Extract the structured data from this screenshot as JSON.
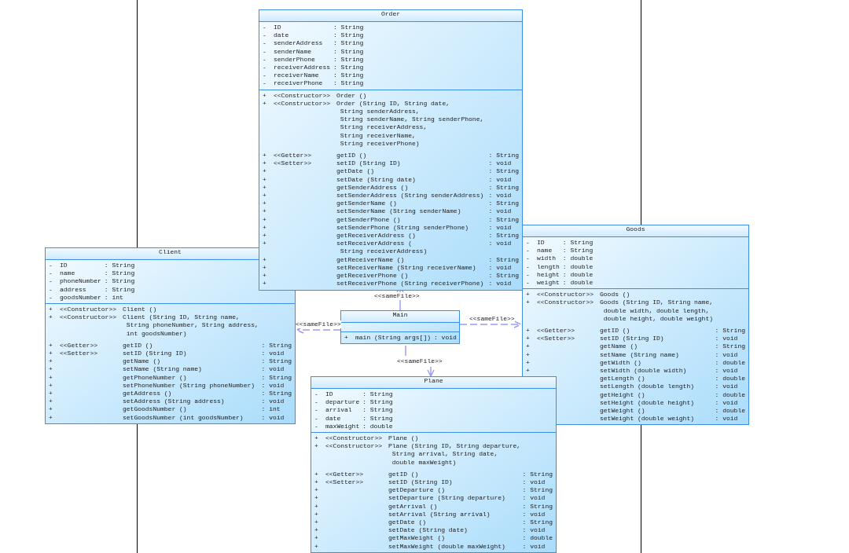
{
  "classes": [
    {
      "name": "Order",
      "attributes": [
        {
          "visibility": "-",
          "name": "ID",
          "type": ": String"
        },
        {
          "visibility": "-",
          "name": "date",
          "type": ": String"
        },
        {
          "visibility": "-",
          "name": "senderAddress",
          "type": ": String"
        },
        {
          "visibility": "-",
          "name": "senderName",
          "type": ": String"
        },
        {
          "visibility": "-",
          "name": "senderPhone",
          "type": ": String"
        },
        {
          "visibility": "-",
          "name": "receiverAddress",
          "type": ": String"
        },
        {
          "visibility": "-",
          "name": "receiverName",
          "type": ": String"
        },
        {
          "visibility": "-",
          "name": "receiverPhone",
          "type": ": String"
        }
      ],
      "operations": [
        {
          "kind": "constructor",
          "visibility": "+",
          "stereotype": "<<Constructor>>",
          "lines": [
            "Order ()"
          ]
        },
        {
          "kind": "constructor",
          "visibility": "+",
          "stereotype": "<<Constructor>>",
          "lines": [
            "Order (String ID, String date,",
            "String senderAddress,",
            "String senderName, String senderPhone,",
            "String receiverAddress,",
            "String receiverName,",
            "String receiverPhone)"
          ]
        },
        {
          "kind": "method",
          "visibility": "+",
          "stereotype": "<<Getter>>",
          "lines": [
            "getID ()"
          ],
          "type": ": String"
        },
        {
          "kind": "method",
          "visibility": "+",
          "stereotype": "<<Setter>>",
          "lines": [
            "setID (String ID)"
          ],
          "type": ": void"
        },
        {
          "kind": "method",
          "visibility": "+",
          "lines": [
            "getDate ()"
          ],
          "type": ": String"
        },
        {
          "kind": "method",
          "visibility": "+",
          "lines": [
            "setDate (String date)"
          ],
          "type": ": void"
        },
        {
          "kind": "method",
          "visibility": "+",
          "lines": [
            "getSenderAddress ()"
          ],
          "type": ": String"
        },
        {
          "kind": "method",
          "visibility": "+",
          "lines": [
            "setSenderAddress (String senderAddress)"
          ],
          "type": ": void"
        },
        {
          "kind": "method",
          "visibility": "+",
          "lines": [
            "getSenderName ()"
          ],
          "type": ": String"
        },
        {
          "kind": "method",
          "visibility": "+",
          "lines": [
            "setSenderName (String senderName)"
          ],
          "type": ": void"
        },
        {
          "kind": "method",
          "visibility": "+",
          "lines": [
            "getSenderPhone ()"
          ],
          "type": ": String"
        },
        {
          "kind": "method",
          "visibility": "+",
          "lines": [
            "setSenderPhone (String senderPhone)"
          ],
          "type": ": void"
        },
        {
          "kind": "method",
          "visibility": "+",
          "lines": [
            "getReceiverAddress ()"
          ],
          "type": ": String"
        },
        {
          "kind": "method",
          "visibility": "+",
          "lines": [
            "setReceiverAddress (",
            "String receiverAddress)"
          ],
          "type": ": void"
        },
        {
          "kind": "method",
          "visibility": "+",
          "lines": [
            "getReceiverName ()"
          ],
          "type": ": String"
        },
        {
          "kind": "method",
          "visibility": "+",
          "lines": [
            "setReceiverName (String receiverName)"
          ],
          "type": ": void"
        },
        {
          "kind": "method",
          "visibility": "+",
          "lines": [
            "getReceiverPhone ()"
          ],
          "type": ": String"
        },
        {
          "kind": "method",
          "visibility": "+",
          "lines": [
            "setReceiverPhone (String receiverPhone)"
          ],
          "type": ": void"
        }
      ]
    },
    {
      "name": "Client",
      "attributes": [
        {
          "visibility": "-",
          "name": "ID",
          "type": ": String"
        },
        {
          "visibility": "-",
          "name": "name",
          "type": ": String"
        },
        {
          "visibility": "-",
          "name": "phoneNumber",
          "type": ": String"
        },
        {
          "visibility": "-",
          "name": "address",
          "type": ": String"
        },
        {
          "visibility": "-",
          "name": "goodsNumber",
          "type": ": int"
        }
      ],
      "operations": [
        {
          "kind": "constructor",
          "visibility": "+",
          "stereotype": "<<Constructor>>",
          "lines": [
            "Client ()"
          ]
        },
        {
          "kind": "constructor",
          "visibility": "+",
          "stereotype": "<<Constructor>>",
          "lines": [
            "Client (String ID, String name,",
            "String phoneNumber, String address,",
            "int goodsNumber)"
          ]
        },
        {
          "kind": "method",
          "visibility": "+",
          "stereotype": "<<Getter>>",
          "lines": [
            "getID ()"
          ],
          "type": ": String"
        },
        {
          "kind": "method",
          "visibility": "+",
          "stereotype": "<<Setter>>",
          "lines": [
            "setID (String ID)"
          ],
          "type": ": void"
        },
        {
          "kind": "method",
          "visibility": "+",
          "lines": [
            "getName ()"
          ],
          "type": ": String"
        },
        {
          "kind": "method",
          "visibility": "+",
          "lines": [
            "setName (String name)"
          ],
          "type": ": void"
        },
        {
          "kind": "method",
          "visibility": "+",
          "lines": [
            "getPhoneNumber ()"
          ],
          "type": ": String"
        },
        {
          "kind": "method",
          "visibility": "+",
          "lines": [
            "setPhoneNumber (String phoneNumber)"
          ],
          "type": ": void"
        },
        {
          "kind": "method",
          "visibility": "+",
          "lines": [
            "getAddress ()"
          ],
          "type": ": String"
        },
        {
          "kind": "method",
          "visibility": "+",
          "lines": [
            "setAddress (String address)"
          ],
          "type": ": void"
        },
        {
          "kind": "method",
          "visibility": "+",
          "lines": [
            "getGoodsNumber ()"
          ],
          "type": ": int"
        },
        {
          "kind": "method",
          "visibility": "+",
          "lines": [
            "setGoodsNumber (int goodsNumber)"
          ],
          "type": ": void"
        }
      ]
    },
    {
      "name": "Main",
      "operations": [
        {
          "kind": "method",
          "visibility": "+",
          "lines": [
            "main (String args[])"
          ],
          "type": ": void"
        }
      ]
    },
    {
      "name": "Goods",
      "attributes": [
        {
          "visibility": "-",
          "name": "ID",
          "type": ": String"
        },
        {
          "visibility": "-",
          "name": "name",
          "type": ": String"
        },
        {
          "visibility": "-",
          "name": "width",
          "type": ": double"
        },
        {
          "visibility": "-",
          "name": "length",
          "type": ": double"
        },
        {
          "visibility": "-",
          "name": "height",
          "type": ": double"
        },
        {
          "visibility": "-",
          "name": "weight",
          "type": ": double"
        }
      ],
      "operations": [
        {
          "kind": "constructor",
          "visibility": "+",
          "stereotype": "<<Constructor>>",
          "lines": [
            "Goods ()"
          ]
        },
        {
          "kind": "constructor",
          "visibility": "+",
          "stereotype": "<<Constructor>>",
          "lines": [
            "Goods (String ID, String name,",
            "double width, double length,",
            "double height, double weight)"
          ]
        },
        {
          "kind": "method",
          "visibility": "+",
          "stereotype": "<<Getter>>",
          "lines": [
            "getID ()"
          ],
          "type": ": String"
        },
        {
          "kind": "method",
          "visibility": "+",
          "stereotype": "<<Setter>>",
          "lines": [
            "setID (String ID)"
          ],
          "type": ": void"
        },
        {
          "kind": "method",
          "visibility": "+",
          "lines": [
            "getName ()"
          ],
          "type": ": String"
        },
        {
          "kind": "method",
          "visibility": "+",
          "lines": [
            "setName (String name)"
          ],
          "type": ": void"
        },
        {
          "kind": "method",
          "visibility": "+",
          "lines": [
            "getWidth ()"
          ],
          "type": ": double"
        },
        {
          "kind": "method",
          "visibility": "+",
          "lines": [
            "setWidth (double width)"
          ],
          "type": ": void"
        },
        {
          "kind": "method",
          "lines": [
            "getLength ()"
          ],
          "type": ": double"
        },
        {
          "kind": "method",
          "lines": [
            "setLength (double length)"
          ],
          "type": ": void"
        },
        {
          "kind": "method",
          "lines": [
            "getHeight ()"
          ],
          "type": ": double"
        },
        {
          "kind": "method",
          "lines": [
            "setHeight (double height)"
          ],
          "type": ": void"
        },
        {
          "kind": "method",
          "lines": [
            "getWeight ()"
          ],
          "type": ": double"
        },
        {
          "kind": "method",
          "lines": [
            "setWeight (double weight)"
          ],
          "type": ": void"
        }
      ]
    },
    {
      "name": "Plane",
      "attributes": [
        {
          "visibility": "-",
          "name": "ID",
          "type": ": String"
        },
        {
          "visibility": "-",
          "name": "departure",
          "type": ": String"
        },
        {
          "visibility": "-",
          "name": "arrival",
          "type": ": String"
        },
        {
          "visibility": "-",
          "name": "date",
          "type": ": String"
        },
        {
          "visibility": "-",
          "name": "maxWeight",
          "type": ": double"
        }
      ],
      "operations": [
        {
          "kind": "constructor",
          "visibility": "+",
          "stereotype": "<<Constructor>>",
          "lines": [
            "Plane ()"
          ]
        },
        {
          "kind": "constructor",
          "visibility": "+",
          "stereotype": "<<Constructor>>",
          "lines": [
            "Plane (String ID, String departure,",
            "String arrival, String date,",
            "double maxWeight)"
          ]
        },
        {
          "kind": "method",
          "visibility": "+",
          "stereotype": "<<Getter>>",
          "lines": [
            "getID ()"
          ],
          "type": ": String"
        },
        {
          "kind": "method",
          "visibility": "+",
          "stereotype": "<<Setter>>",
          "lines": [
            "setID (String ID)"
          ],
          "type": ": void"
        },
        {
          "kind": "method",
          "visibility": "+",
          "lines": [
            "getDeparture ()"
          ],
          "type": ": String"
        },
        {
          "kind": "method",
          "visibility": "+",
          "lines": [
            "setDeparture (String departure)"
          ],
          "type": ": void"
        },
        {
          "kind": "method",
          "visibility": "+",
          "lines": [
            "getArrival ()"
          ],
          "type": ": String"
        },
        {
          "kind": "method",
          "visibility": "+",
          "lines": [
            "setArrival (String arrival)"
          ],
          "type": ": void"
        },
        {
          "kind": "method",
          "visibility": "+",
          "lines": [
            "getDate ()"
          ],
          "type": ": String"
        },
        {
          "kind": "method",
          "visibility": "+",
          "lines": [
            "setDate (String date)"
          ],
          "type": ": void"
        },
        {
          "kind": "method",
          "visibility": "+",
          "lines": [
            "getMaxWeight ()"
          ],
          "type": ": double"
        },
        {
          "kind": "method",
          "visibility": "+",
          "lines": [
            "setMaxWeight (double maxWeight)"
          ],
          "type": ": void"
        }
      ]
    }
  ],
  "relations": [
    {
      "kind": "up",
      "label": "<<sameFile>>"
    },
    {
      "kind": "left",
      "label": "<<sameFile>>"
    },
    {
      "kind": "right",
      "label": "<<sameFile>>"
    },
    {
      "kind": "down",
      "label": "<<sameFile>>"
    }
  ]
}
